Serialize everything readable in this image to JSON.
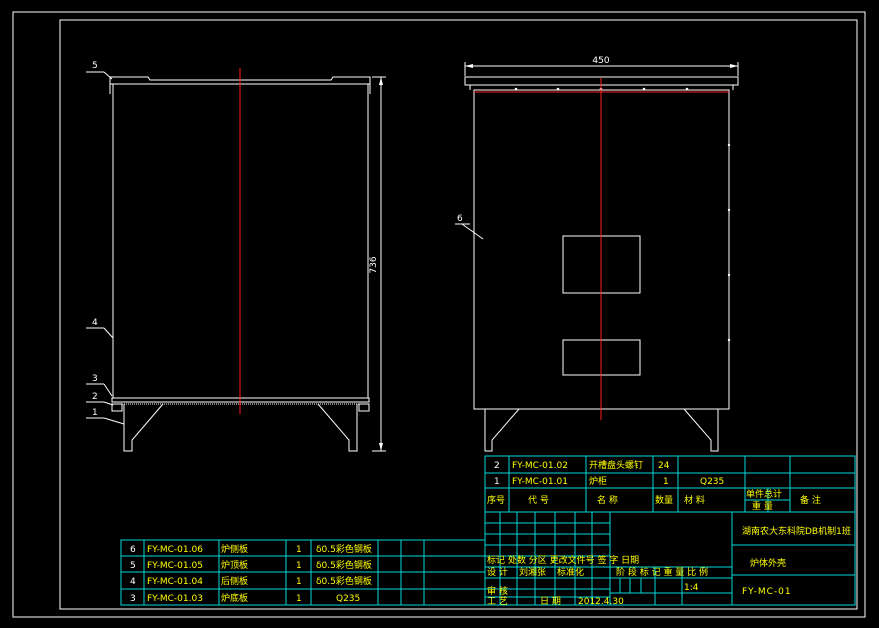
{
  "colors": {
    "background": "#000000",
    "outline": "#ffffff",
    "table_lines": "#00d8d8",
    "centerline": "#ff2020",
    "text_yellow": "#ffff00",
    "text_green": "#00ff00",
    "text_cyan": "#00e0e0"
  },
  "views": {
    "side": {
      "dim_height": "736",
      "balloons": [
        "5",
        "4",
        "3",
        "2",
        "1"
      ]
    },
    "front": {
      "dim_width": "450",
      "balloons": [
        "6"
      ]
    }
  },
  "parts_upper": [
    {
      "no": "2",
      "code": "FY-MC-01.02",
      "name": "开槽盘头螺钉",
      "qty": "24",
      "material": "",
      "remark": ""
    },
    {
      "no": "1",
      "code": "FY-MC-01.01",
      "name": "炉柜",
      "qty": "1",
      "material": "Q235",
      "remark": ""
    }
  ],
  "parts_header": {
    "no": "序号",
    "code": "代 号",
    "name": "名 称",
    "qty": "数量",
    "material": "材 料",
    "unit_weight": "单件总计",
    "weight": "重 量",
    "remark": "备 注"
  },
  "parts_lower": [
    {
      "no": "6",
      "code": "FY-MC-01.06",
      "name": "炉侧板",
      "qty": "1",
      "material": "δ0.5彩色钢板"
    },
    {
      "no": "5",
      "code": "FY-MC-01.05",
      "name": "炉顶板",
      "qty": "1",
      "material": "δ0.5彩色钢板"
    },
    {
      "no": "4",
      "code": "FY-MC-01.04",
      "name": "后侧板",
      "qty": "1",
      "material": "δ0.5彩色钢板"
    },
    {
      "no": "3",
      "code": "FY-MC-01.03",
      "name": "炉底板",
      "qty": "1",
      "material": "Q235"
    }
  ],
  "title_block": {
    "company": "湖南农大东科院DB机制1班",
    "drawing_name": "炉体外壳",
    "drawing_no": "FY-MC-01",
    "scale": "1:4",
    "stage_labels": "阶 段 标 记   重 量   比 例",
    "rev_labels": "标记 处数 分区 更改文件号 签 字 日期",
    "design_label": "设 计",
    "designer": "刘湘张",
    "standard_label": "标准化",
    "review_label": "审 核",
    "process_label": "工 艺",
    "date_label": "日 期",
    "date": "2012.4.30"
  }
}
